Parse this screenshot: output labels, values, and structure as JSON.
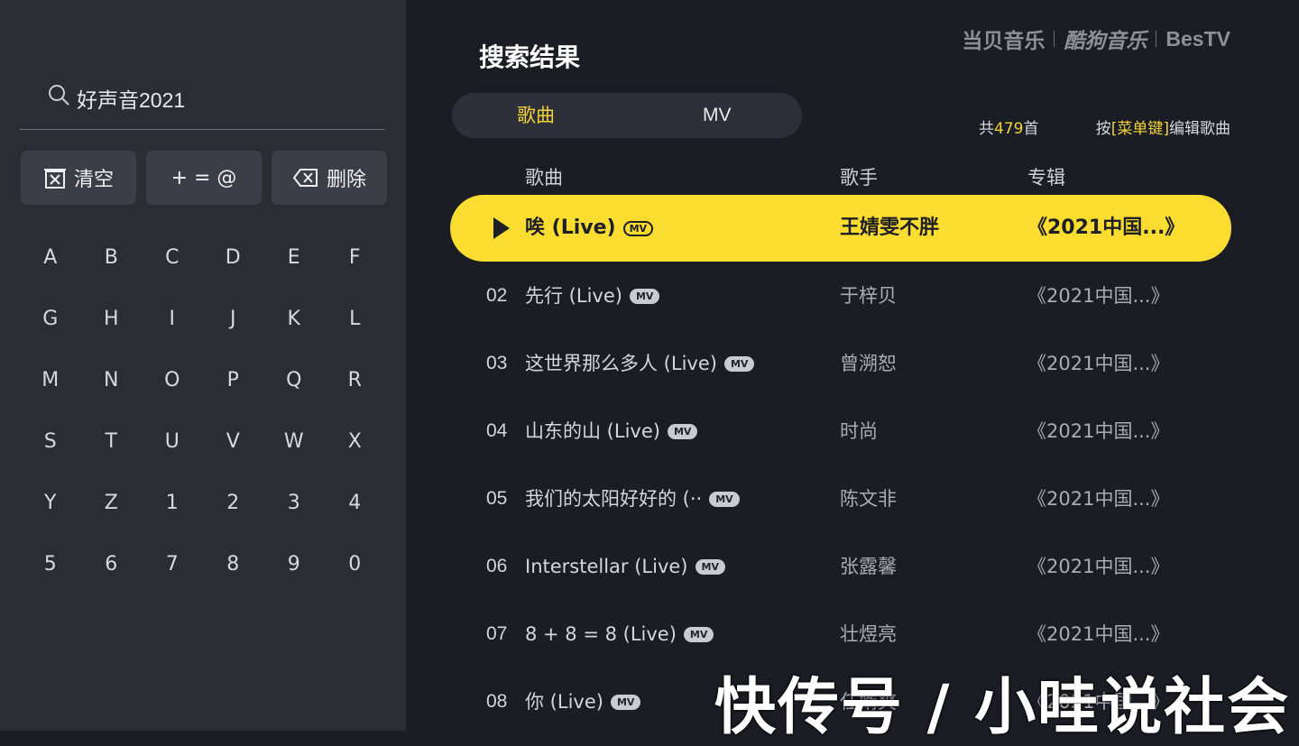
{
  "search": {
    "query": "好声音2021"
  },
  "functions": {
    "clear": "清空",
    "symbols": "+ = @",
    "delete": "删除"
  },
  "keyboard": [
    "A",
    "B",
    "C",
    "D",
    "E",
    "F",
    "G",
    "H",
    "I",
    "J",
    "K",
    "L",
    "M",
    "N",
    "O",
    "P",
    "Q",
    "R",
    "S",
    "T",
    "U",
    "V",
    "W",
    "X",
    "Y",
    "Z",
    "1",
    "2",
    "3",
    "4",
    "5",
    "6",
    "7",
    "8",
    "9",
    "0"
  ],
  "header": {
    "title": "搜索结果",
    "brands": [
      "当贝音乐",
      "酷狗音乐",
      "BesTV"
    ]
  },
  "tabs": {
    "songs": "歌曲",
    "mv": "MV"
  },
  "summary": {
    "total_prefix": "共",
    "total_count": "479",
    "total_suffix": "首",
    "hint_prefix": "按",
    "hint_key": "[菜单键]",
    "hint_suffix": "编辑歌曲"
  },
  "columns": {
    "song": "歌曲",
    "singer": "歌手",
    "album": "专辑"
  },
  "mv_badge": "MV",
  "songs": [
    {
      "num": "",
      "title": "唉 (Live)",
      "singer": "王婧雯不胖",
      "album": "《2021中国...》"
    },
    {
      "num": "02",
      "title": "先行 (Live)",
      "singer": "于梓贝",
      "album": "《2021中国...》"
    },
    {
      "num": "03",
      "title": "这世界那么多人 (Live)",
      "singer": "曾溯恕",
      "album": "《2021中国...》"
    },
    {
      "num": "04",
      "title": "山东的山 (Live)",
      "singer": "时尚",
      "album": "《2021中国...》"
    },
    {
      "num": "05",
      "title": "我们的太阳好好的 (··",
      "singer": "陈文非",
      "album": "《2021中国...》"
    },
    {
      "num": "06",
      "title": "Interstellar (Live)",
      "singer": "张露馨",
      "album": "《2021中国...》"
    },
    {
      "num": "07",
      "title": "8 + 8 = 8 (Live)",
      "singer": "壮煜亮",
      "album": "《2021中国...》"
    },
    {
      "num": "08",
      "title": "你 (Live)",
      "singer": "任婿爽",
      "album": "《2021中国...》"
    }
  ],
  "watermark": "快传号 / 小哇说社会"
}
